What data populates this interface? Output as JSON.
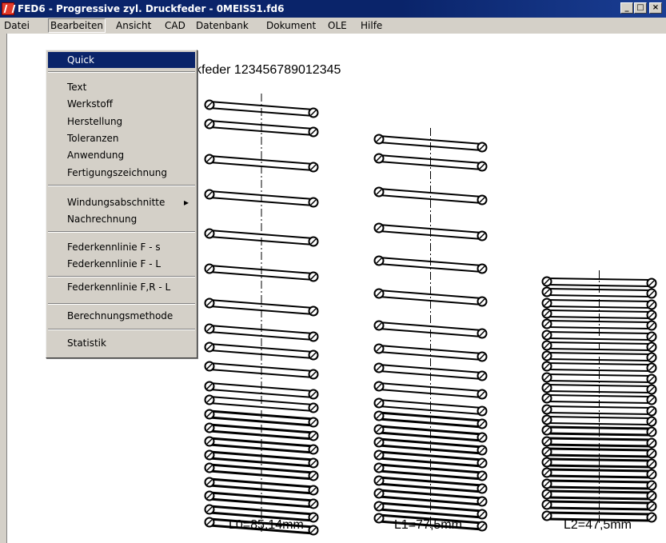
{
  "window": {
    "title": "FED6 - Progressive zyl. Druckfeder  -  0MEISS1.fd6"
  },
  "titlebar_buttons": [
    "minimize-icon",
    "maximize-icon",
    "close-icon"
  ],
  "menubar": [
    "Datei",
    "Bearbeiten",
    "Ansicht",
    "CAD",
    "Datenbank",
    "Dokument",
    "OLE",
    "Hilfe"
  ],
  "menu_open": "Bearbeiten",
  "dropdown": {
    "items": [
      {
        "label": "Quick",
        "selected": true
      },
      {
        "label": "Text"
      },
      {
        "label": "Werkstoff"
      },
      {
        "label": "Herstellung"
      },
      {
        "label": "Toleranzen"
      },
      {
        "label": "Anwendung"
      },
      {
        "label": "Fertigungszeichnung"
      },
      {
        "label": "Windungsabschnitte",
        "submenu": true
      },
      {
        "label": "Nachrechnung"
      },
      {
        "label": "Federkennlinie F - s"
      },
      {
        "label": "Federkennlinie F - L"
      },
      {
        "label": "Federkennlinie F,R - L"
      },
      {
        "label": "Berechnungsmethode"
      },
      {
        "label": "Statistik"
      }
    ]
  },
  "document": {
    "title_visible": "ckfeder 123456789012345",
    "springs": [
      {
        "label": "L0=85,14mm"
      },
      {
        "label": "L1=77,5mm"
      },
      {
        "label": "L2=47,5mm"
      }
    ]
  }
}
